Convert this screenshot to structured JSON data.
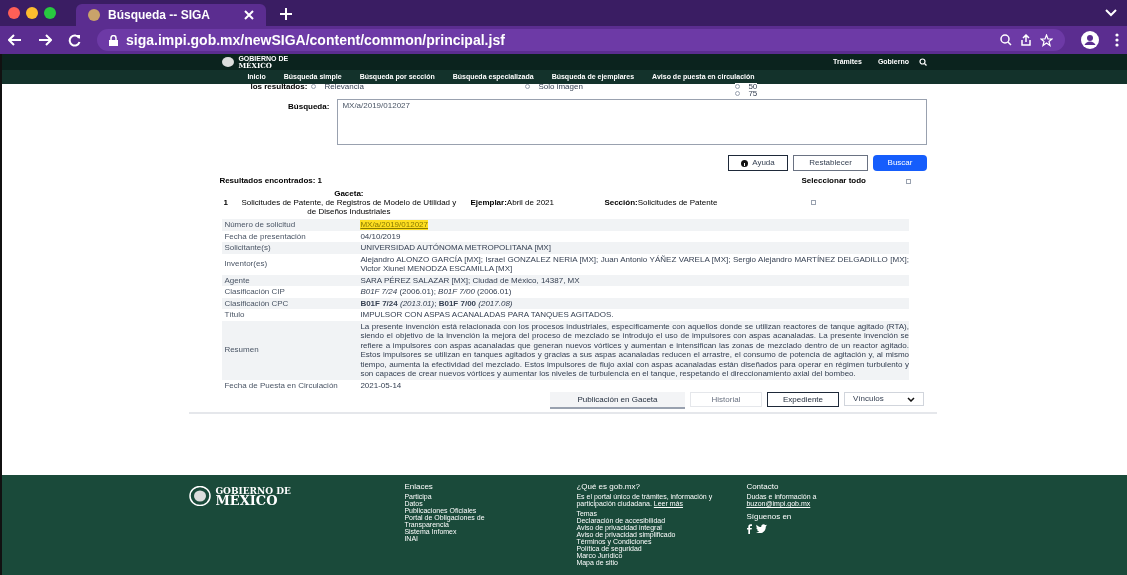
{
  "browser": {
    "tab_title": "Búsqueda -- SIGA",
    "url": "siga.impi.gob.mx/newSIGA/content/common/principal.jsf"
  },
  "header": {
    "logo_small": "GOBIERNO DE",
    "logo_big": "MÉXICO",
    "top_links": [
      "Trámites",
      "Gobierno"
    ],
    "nav": [
      "Inicio",
      "Búsqueda simple",
      "Búsqueda por sección",
      "Búsqueda especializada",
      "Búsqueda de ejemplares",
      "Aviso de puesta en circulación"
    ]
  },
  "search": {
    "order_label": "los resultados:",
    "options": [
      {
        "label": "Relevancia",
        "selected": false
      },
      {
        "label": "Solo imagen",
        "selected": false
      }
    ],
    "counts": [
      {
        "label": "50",
        "selected": false
      },
      {
        "label": "75",
        "selected": false
      }
    ],
    "query_label": "Búsqueda:",
    "query": "MX/a/2019/012027",
    "buttons": [
      {
        "kind": "help",
        "label": "Ayuda"
      },
      {
        "kind": "outline",
        "label": "Restablecer"
      },
      {
        "kind": "primary",
        "label": "Buscar"
      }
    ]
  },
  "results": {
    "count": "Resultados encontrados: 1",
    "select_all": "Seleccionar todo",
    "select_all_checked": false,
    "item": {
      "number": "1",
      "gaceta_label": "Gaceta:",
      "gaceta": "Solicitudes de Patente, de Registros de Modelo de Utilidad y de Diseños Industriales",
      "ejemplar_label": "Ejemplar:",
      "ejemplar": "Abril de 2021",
      "seccion_label": "Sección:",
      "seccion": "Solicitudes de Patente",
      "checked": false
    },
    "fields": [
      {
        "label": "Número de solicitud",
        "value": "MX/a/2019/012027",
        "kind": "link"
      },
      {
        "label": "Fecha de presentación",
        "value": "04/10/2019",
        "kind": "text"
      },
      {
        "label": "Solicitante(s)",
        "value": "UNIVERSIDAD AUTÓNOMA METROPOLITANA [MX]",
        "kind": "text"
      },
      {
        "label": "Inventor(es)",
        "value": "Alejandro ALONZO GARCÍA [MX]; Israel GONZALEZ NERIA [MX]; Juan Antonio YÁÑEZ VARELA [MX]; Sergio Alejandro MARTÍNEZ DELGADILLO [MX]; Victor Xiunel MENODZA ESCAMILLA [MX]",
        "kind": "text"
      },
      {
        "label": "Agente",
        "value": "SARA PÉREZ SALAZAR [MX]; Ciudad de México, 14387, MX",
        "kind": "text"
      },
      {
        "label": "Clasificación CIP",
        "value": "*B01F 7/24* (2006.01); *B01F 7/00* (2006.01)",
        "kind": "rich"
      },
      {
        "label": "Clasificación CPC",
        "value": "**B01F 7/24** *(2013.01)*; **B01F 7/00** *(2017.08)*",
        "kind": "rich"
      },
      {
        "label": "Título",
        "value": "IMPULSOR CON ASPAS ACANALADAS PARA TANQUES AGITADOS.",
        "kind": "text"
      },
      {
        "label": "Resumen",
        "value": "La presente invención está relacionada con los procesos industriales, específicamente con aquellos donde se utilizan reactores de tanque agitado (RTA), siendo el objetivo de la invención la mejora del proceso de mezclado se introdujo el uso de impulsores con aspas acanaladas. La presente invención se refiere a impulsores con aspas acanaladas que generan nuevos vórtices y aumentan e intensifican las zonas de mezclado dentro de un reactor agitado. Estos impulsores se utilizan en tanques agitados y gracias a sus aspas acanaladas reducen el arrastre, el consumo de potencia de agitación y, al mismo tiempo, aumenta la efectividad del mezclado. Estos impulsores de flujo axial con aspas acanaladas están diseñados para operar en régimen turbulento y son capaces de crear nuevos vórtices y aumentar los niveles de turbulencia en el tanque, respetando el direccionamiento axial del bombeo.",
        "kind": "text"
      },
      {
        "label": "Fecha de Puesta en Circulación",
        "value": "2021-05-14",
        "kind": "text"
      }
    ],
    "actions": [
      {
        "label": "Publicación en Gaceta",
        "kind": "tab",
        "disabled": false
      },
      {
        "label": "Historial",
        "kind": "outline",
        "disabled": true
      },
      {
        "label": "Expediente",
        "kind": "outline",
        "disabled": false
      },
      {
        "label": "Vínculos",
        "kind": "select",
        "disabled": false
      }
    ]
  },
  "footer": {
    "logo_small": "GOBIERNO DE",
    "logo_big": "MÉXICO",
    "links_title": "Enlaces",
    "links": [
      "Participa",
      "Datos",
      "Publicaciones Oficiales",
      "Portal de Obligaciones de Transparencia",
      "Sistema Infomex",
      "INAI"
    ],
    "about_title": "¿Qué es gob.mx?",
    "about_text": "Es el portal único de trámites, información y participación ciudadana.",
    "about_link": "Leer más",
    "themes_title": "Temas",
    "themes": [
      "Declaración de accesibilidad",
      "Aviso de privacidad integral",
      "Aviso de privacidad simplificado",
      "Términos y Condiciones",
      "Política de seguridad",
      "Marco Jurídico",
      "Mapa de sitio"
    ],
    "contact_title": "Contacto",
    "contact_text": "Dudas e información a",
    "contact_email": "buzon@impi.gob.mx",
    "follow": "Síguenos en"
  }
}
